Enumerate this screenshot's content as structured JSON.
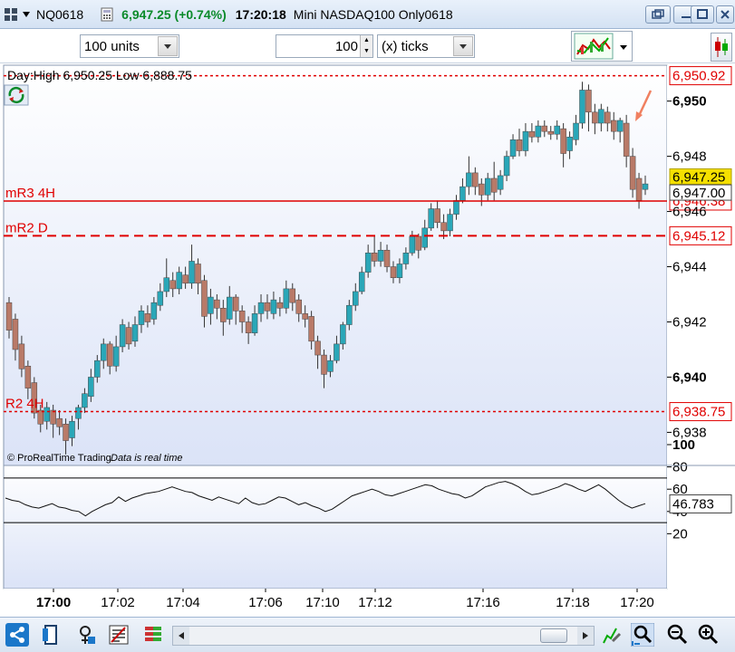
{
  "titlebar": {
    "symbol": "NQ0618",
    "price_change": "6,947.25 (+0.74%)",
    "time": "17:20:18",
    "instrument_name": "Mini NASDAQ100 Only0618",
    "dropdown_icon": "chevron-down-icon",
    "window_buttons": [
      "restore-icon",
      "minimize-icon",
      "maximize-icon",
      "close-icon"
    ]
  },
  "toolbar": {
    "units_value": "100 units",
    "ticks_value": "100",
    "ticks_unit": "(x) ticks"
  },
  "chart": {
    "day_range_text": "Day:High 6,950.25 Low 6,888.75",
    "footer_brand": "© ProRealTime Trading",
    "footer_status": "Data is real time",
    "level_labels": {
      "mR3": "mR3 4H",
      "mR2": "mR2 D",
      "R2": "R2 4H"
    },
    "level_tags": {
      "top": "6,950.92",
      "mR3": "6,946.38",
      "mR2": "6,945.12",
      "R2": "6,938.75"
    },
    "price_tags": {
      "last": "6,947.25",
      "current": "6,947.00"
    },
    "indicator_tag": "46.783",
    "colors": {
      "up": "#2aa7b8",
      "down": "#b97a68",
      "level": "#e00000",
      "last_price_bg": "#f5e000",
      "panel_bg_top": "#ffffff",
      "panel_bg_bottom": "#dbe3f7"
    }
  },
  "chart_data": {
    "type": "candlestick",
    "title": "",
    "y_ticks": [
      "6,950",
      "6,948",
      "6,946",
      "6,944",
      "6,942",
      "6,940",
      "6,938"
    ],
    "x_ticks": [
      "17:00",
      "17:02",
      "17:04",
      "17:06",
      "17:10",
      "17:12",
      "17:16",
      "17:18",
      "17:20"
    ],
    "ylim": [
      6936.8,
      6951.3
    ],
    "candles": [
      [
        6942.7,
        6941.7,
        6942.9,
        6941.4
      ],
      [
        6942.1,
        6941.0,
        6942.3,
        6940.6
      ],
      [
        6941.2,
        6940.3,
        6941.5,
        6940.0
      ],
      [
        6940.4,
        6939.6,
        6940.6,
        6939.2
      ],
      [
        6939.8,
        6938.7,
        6940.0,
        6938.5
      ],
      [
        6938.8,
        6938.3,
        6939.0,
        6938.0
      ],
      [
        6938.4,
        6938.9,
        6939.1,
        6938.1
      ],
      [
        6938.8,
        6938.3,
        6939.0,
        6937.8
      ],
      [
        6938.5,
        6938.2,
        6938.8,
        6937.9
      ],
      [
        6938.3,
        6937.7,
        6938.5,
        6937.2
      ],
      [
        6937.8,
        6938.4,
        6938.6,
        6937.5
      ],
      [
        6938.5,
        6938.9,
        6939.0,
        6938.1
      ],
      [
        6938.9,
        6939.4,
        6939.6,
        6938.7
      ],
      [
        6939.3,
        6940.0,
        6940.3,
        6939.1
      ],
      [
        6940.0,
        6940.6,
        6940.8,
        6939.8
      ],
      [
        6940.6,
        6941.2,
        6941.4,
        6940.3
      ],
      [
        6941.2,
        6940.4,
        6941.3,
        6940.1
      ],
      [
        6940.4,
        6941.1,
        6941.5,
        6940.2
      ],
      [
        6941.1,
        6941.9,
        6942.1,
        6940.9
      ],
      [
        6941.8,
        6941.2,
        6942.0,
        6941.0
      ],
      [
        6941.3,
        6941.9,
        6942.2,
        6941.1
      ],
      [
        6941.9,
        6942.4,
        6942.6,
        6941.6
      ],
      [
        6942.3,
        6942.0,
        6942.6,
        6941.8
      ],
      [
        6942.1,
        6942.7,
        6942.9,
        6941.9
      ],
      [
        6942.6,
        6943.1,
        6943.4,
        6942.4
      ],
      [
        6943.1,
        6943.6,
        6944.3,
        6942.9
      ],
      [
        6943.5,
        6943.2,
        6943.8,
        6942.9
      ],
      [
        6943.2,
        6943.8,
        6944.0,
        6943.0
      ],
      [
        6943.7,
        6943.4,
        6944.0,
        6943.2
      ],
      [
        6943.4,
        6944.2,
        6944.8,
        6943.2
      ],
      [
        6944.1,
        6943.4,
        6944.3,
        6943.0
      ],
      [
        6943.5,
        6942.2,
        6943.7,
        6941.8
      ],
      [
        6942.3,
        6942.9,
        6943.2,
        6941.9
      ],
      [
        6942.8,
        6942.5,
        6943.0,
        6942.1
      ],
      [
        6942.5,
        6942.0,
        6942.8,
        6941.5
      ],
      [
        6942.1,
        6942.9,
        6943.3,
        6941.9
      ],
      [
        6942.9,
        6942.4,
        6943.0,
        6941.9
      ],
      [
        6942.4,
        6942.0,
        6942.6,
        6941.6
      ],
      [
        6942.0,
        6941.6,
        6942.2,
        6941.2
      ],
      [
        6941.6,
        6942.3,
        6942.6,
        6941.5
      ],
      [
        6942.3,
        6942.7,
        6943.0,
        6942.0
      ],
      [
        6942.7,
        6942.4,
        6943.0,
        6942.1
      ],
      [
        6942.3,
        6942.8,
        6943.1,
        6942.1
      ],
      [
        6942.7,
        6942.5,
        6942.9,
        6942.2
      ],
      [
        6942.5,
        6943.2,
        6943.5,
        6942.3
      ],
      [
        6943.2,
        6942.7,
        6943.4,
        6942.4
      ],
      [
        6942.8,
        6942.3,
        6943.0,
        6942.0
      ],
      [
        6942.3,
        6942.1,
        6942.6,
        6941.8
      ],
      [
        6942.2,
        6941.3,
        6942.4,
        6941.0
      ],
      [
        6941.3,
        6940.8,
        6941.5,
        6940.3
      ],
      [
        6940.8,
        6940.1,
        6941.0,
        6939.6
      ],
      [
        6940.2,
        6940.6,
        6940.8,
        6940.0
      ],
      [
        6940.6,
        6941.2,
        6941.5,
        6940.5
      ],
      [
        6941.2,
        6941.9,
        6942.0,
        6941.0
      ],
      [
        6941.9,
        6942.6,
        6942.8,
        6941.7
      ],
      [
        6942.6,
        6943.1,
        6943.4,
        6942.4
      ],
      [
        6943.1,
        6943.8,
        6944.0,
        6943.0
      ],
      [
        6943.8,
        6944.5,
        6944.8,
        6943.6
      ],
      [
        6944.5,
        6944.2,
        6945.1,
        6944.0
      ],
      [
        6944.2,
        6944.6,
        6944.9,
        6944.0
      ],
      [
        6944.6,
        6944.0,
        6944.8,
        6943.8
      ],
      [
        6944.0,
        6943.6,
        6944.2,
        6943.4
      ],
      [
        6943.6,
        6944.1,
        6944.3,
        6943.4
      ],
      [
        6944.1,
        6944.5,
        6944.7,
        6943.9
      ],
      [
        6944.5,
        6945.1,
        6945.3,
        6944.4
      ],
      [
        6945.1,
        6944.6,
        6945.2,
        6944.3
      ],
      [
        6944.7,
        6945.4,
        6945.7,
        6944.6
      ],
      [
        6945.4,
        6946.1,
        6946.3,
        6945.3
      ],
      [
        6946.1,
        6945.6,
        6946.4,
        6945.4
      ],
      [
        6945.6,
        6945.3,
        6945.9,
        6945.0
      ],
      [
        6945.3,
        6945.9,
        6946.1,
        6945.1
      ],
      [
        6945.9,
        6946.4,
        6946.6,
        6945.7
      ],
      [
        6946.4,
        6946.9,
        6947.2,
        6946.3
      ],
      [
        6946.9,
        6947.4,
        6948.0,
        6946.6
      ],
      [
        6947.4,
        6946.9,
        6947.6,
        6946.6
      ],
      [
        6947.0,
        6946.6,
        6947.2,
        6946.2
      ],
      [
        6946.6,
        6947.2,
        6947.4,
        6946.4
      ],
      [
        6947.2,
        6946.7,
        6947.8,
        6946.4
      ],
      [
        6946.8,
        6947.3,
        6947.5,
        6946.6
      ],
      [
        6947.3,
        6948.0,
        6948.2,
        6947.1
      ],
      [
        6948.0,
        6948.6,
        6948.8,
        6947.9
      ],
      [
        6948.6,
        6948.2,
        6949.0,
        6948.0
      ],
      [
        6948.2,
        6948.9,
        6949.2,
        6948.0
      ],
      [
        6948.9,
        6948.7,
        6949.2,
        6948.5
      ],
      [
        6948.7,
        6949.1,
        6949.3,
        6948.5
      ],
      [
        6949.1,
        6948.9,
        6949.3,
        6948.7
      ],
      [
        6948.9,
        6948.8,
        6949.1,
        6948.6
      ],
      [
        6948.8,
        6949.1,
        6949.3,
        6948.6
      ],
      [
        6949.0,
        6948.1,
        6949.2,
        6947.6
      ],
      [
        6948.2,
        6948.7,
        6948.9,
        6947.9
      ],
      [
        6948.6,
        6949.2,
        6949.5,
        6948.4
      ],
      [
        6949.2,
        6950.4,
        6950.7,
        6949.0
      ],
      [
        6950.4,
        6949.6,
        6950.6,
        6948.9
      ],
      [
        6949.6,
        6949.2,
        6949.9,
        6948.8
      ],
      [
        6949.2,
        6949.7,
        6949.9,
        6948.9
      ],
      [
        6949.6,
        6949.2,
        6949.8,
        6948.9
      ],
      [
        6949.3,
        6948.9,
        6949.6,
        6948.6
      ],
      [
        6948.9,
        6949.3,
        6949.4,
        6948.5
      ],
      [
        6949.2,
        6948.0,
        6949.5,
        6947.6
      ],
      [
        6948.0,
        6946.8,
        6948.3,
        6946.5
      ],
      [
        6947.2,
        6946.4,
        6947.4,
        6946.1
      ],
      [
        6946.8,
        6947.0,
        6947.3,
        6946.6
      ]
    ],
    "indicator": {
      "name": "",
      "ylim": [
        0,
        100
      ],
      "y_ticks": [
        "100",
        "80",
        "60",
        "40",
        "20"
      ],
      "upper_band": 70,
      "lower_band": 30,
      "values": [
        52,
        50,
        49,
        46,
        44,
        43,
        45,
        47,
        44,
        43,
        41,
        40,
        36,
        40,
        43,
        46,
        48,
        53,
        49,
        52,
        54,
        56,
        57,
        58,
        60,
        62,
        60,
        58,
        57,
        54,
        52,
        50,
        53,
        51,
        49,
        47,
        52,
        48,
        46,
        47,
        50,
        53,
        52,
        49,
        46,
        48,
        45,
        43,
        40,
        42,
        46,
        50,
        54,
        56,
        58,
        60,
        58,
        55,
        54,
        56,
        58,
        60,
        62,
        64,
        63,
        60,
        58,
        56,
        55,
        52,
        54,
        58,
        62,
        64,
        66,
        67,
        65,
        62,
        58,
        55,
        56,
        58,
        60,
        62,
        65,
        63,
        60,
        58,
        61,
        64,
        60,
        55,
        50,
        46,
        43,
        45,
        47
      ]
    }
  }
}
